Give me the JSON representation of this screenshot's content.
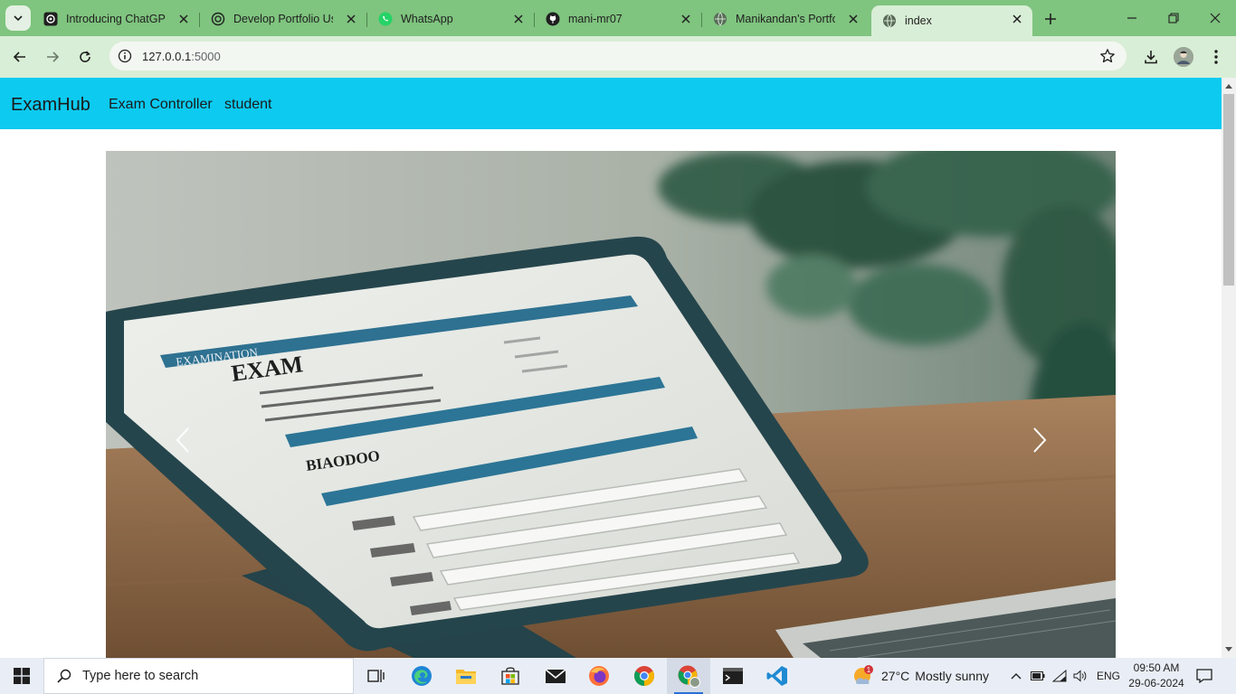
{
  "browser": {
    "tabs": [
      {
        "title": "Introducing ChatGPT",
        "icon": "chatgpt-icon",
        "active": false
      },
      {
        "title": "Develop Portfolio Usi",
        "icon": "chatgpt-icon",
        "active": false
      },
      {
        "title": "WhatsApp",
        "icon": "whatsapp-icon",
        "active": false
      },
      {
        "title": "mani-mr07",
        "icon": "github-icon",
        "active": false
      },
      {
        "title": "Manikandan's Portfol",
        "icon": "globe-icon",
        "active": false
      },
      {
        "title": "index",
        "icon": "globe-icon",
        "active": true
      }
    ],
    "url_host": "127.0.0.1",
    "url_port": ":5000"
  },
  "page": {
    "brand": "ExamHub",
    "nav": [
      "Exam Controller",
      "student"
    ],
    "carousel": {
      "slide_image": "laptop-exam-form-photo",
      "screen_heading": "EXAM",
      "screen_header_strip": "EXAMINATION",
      "screen_subheading": "BIAODOO"
    }
  },
  "taskbar": {
    "search_placeholder": "Type here to search",
    "weather_temp": "27°C",
    "weather_condition": "Mostly sunny",
    "weather_badge": "1",
    "language": "ENG",
    "time": "09:50 AM",
    "date": "29-06-2024"
  },
  "colors": {
    "navbar": "#0dcaf0",
    "tabstrip": "#7fc47f",
    "toolbar": "#d9eed6",
    "taskbar": "#e9eef6"
  }
}
